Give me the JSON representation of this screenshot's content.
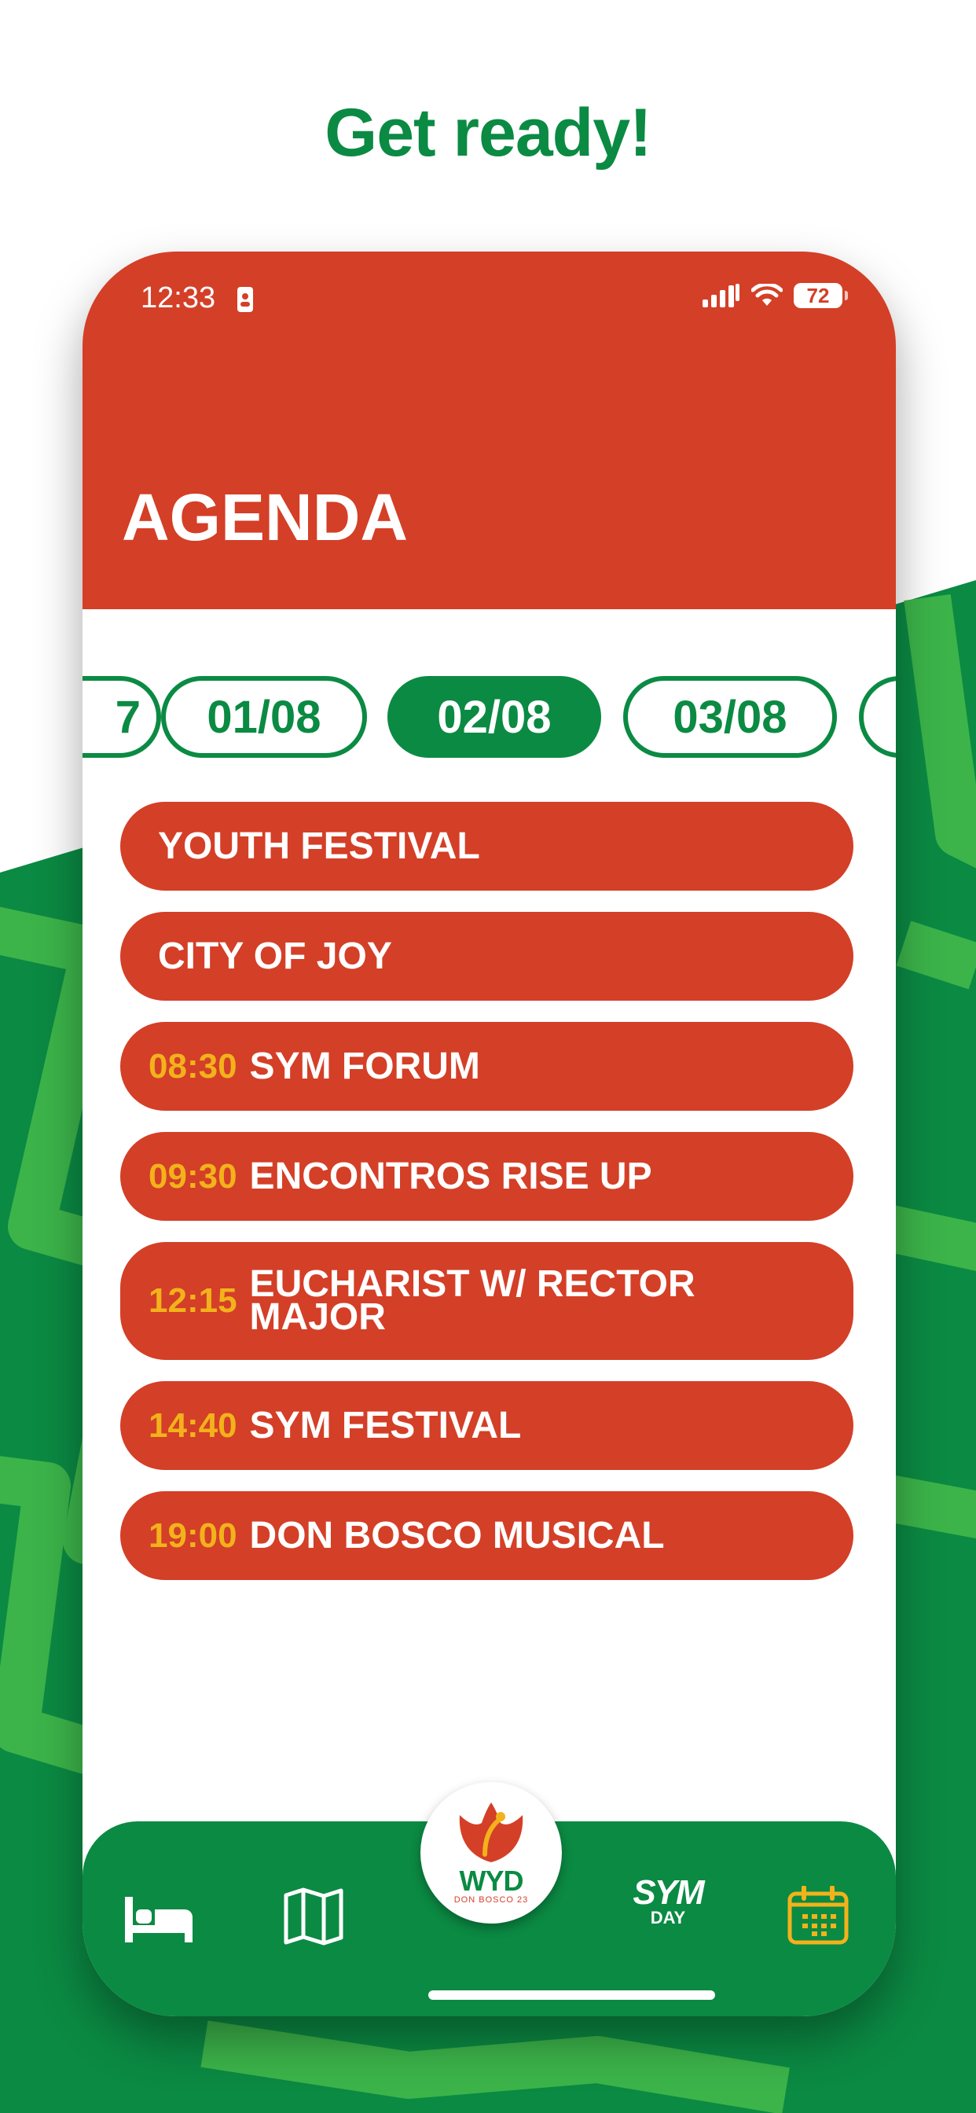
{
  "headline": "Get ready!",
  "status_bar": {
    "time": "12:33",
    "battery": "72"
  },
  "page_title": "AGENDA",
  "dates": [
    {
      "label": "7",
      "active": false
    },
    {
      "label": "01/08",
      "active": false
    },
    {
      "label": "02/08",
      "active": true
    },
    {
      "label": "03/08",
      "active": false
    },
    {
      "label": "",
      "active": false
    }
  ],
  "events": [
    {
      "time": "",
      "name": "YOUTH FESTIVAL"
    },
    {
      "time": "",
      "name": "CITY OF JOY"
    },
    {
      "time": "08:30",
      "name": "SYM FORUM"
    },
    {
      "time": "09:30",
      "name": "ENCONTROS RISE UP"
    },
    {
      "time": "12:15",
      "name": "EUCHARIST W/ RECTOR MAJOR"
    },
    {
      "time": "14:40",
      "name": "SYM FESTIVAL"
    },
    {
      "time": "19:00",
      "name": "DON BOSCO MUSICAL"
    }
  ],
  "tabbar": {
    "items": [
      "bed-icon",
      "map-icon",
      "wyd-logo",
      "sym-day",
      "calendar-icon"
    ],
    "logo_text": "WYD",
    "logo_sub": "DON BOSCO 23",
    "sym_top": "SYM",
    "sym_bottom": "DAY",
    "active": "calendar-icon"
  },
  "colors": {
    "green": "#0b8a43",
    "red": "#d43f27",
    "yellow": "#f2b21b",
    "light_green": "#3cb44a"
  }
}
